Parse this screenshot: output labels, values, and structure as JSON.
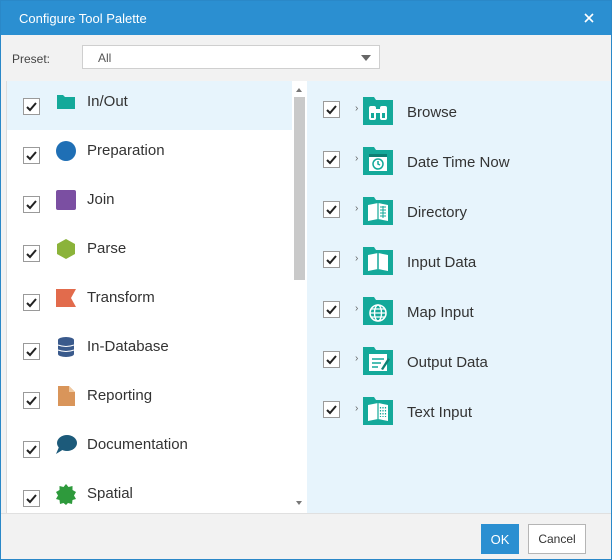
{
  "dialog": {
    "title": "Configure Tool Palette",
    "close_icon": "close-icon"
  },
  "preset": {
    "label": "Preset:",
    "value": "All"
  },
  "categories": [
    {
      "label": "In/Out",
      "checked": true,
      "selected": true,
      "icon": "folder-icon",
      "color": "#14a99a"
    },
    {
      "label": "Preparation",
      "checked": true,
      "icon": "circle-icon",
      "color": "#1f6fb5"
    },
    {
      "label": "Join",
      "checked": true,
      "icon": "square-icon",
      "color": "#7b4fa2"
    },
    {
      "label": "Parse",
      "checked": true,
      "icon": "hexagon-icon",
      "color": "#8bb33a"
    },
    {
      "label": "Transform",
      "checked": true,
      "icon": "ribbon-icon",
      "color": "#e26b4c"
    },
    {
      "label": "In-Database",
      "checked": true,
      "icon": "database-icon",
      "color": "#3a5a8c"
    },
    {
      "label": "Reporting",
      "checked": true,
      "icon": "document-icon",
      "color": "#d9955a"
    },
    {
      "label": "Documentation",
      "checked": true,
      "icon": "speech-bubble-icon",
      "color": "#1c5a7a"
    },
    {
      "label": "Spatial",
      "checked": true,
      "icon": "badge-icon",
      "color": "#2e9a3c"
    }
  ],
  "tools": [
    {
      "label": "Browse",
      "checked": true,
      "icon": "binoculars-icon"
    },
    {
      "label": "Date Time Now",
      "checked": true,
      "icon": "calendar-clock-icon"
    },
    {
      "label": "Directory",
      "checked": true,
      "icon": "directory-book-icon"
    },
    {
      "label": "Input Data",
      "checked": true,
      "icon": "open-book-icon"
    },
    {
      "label": "Map Input",
      "checked": true,
      "icon": "globe-icon"
    },
    {
      "label": "Output Data",
      "checked": true,
      "icon": "output-document-icon"
    },
    {
      "label": "Text Input",
      "checked": true,
      "icon": "text-book-icon"
    }
  ],
  "colors": {
    "accent": "#2b8fd1",
    "tool_green": "#14a99a",
    "selected_row": "#e7f4fc"
  },
  "footer": {
    "ok_label": "OK",
    "cancel_label": "Cancel"
  }
}
